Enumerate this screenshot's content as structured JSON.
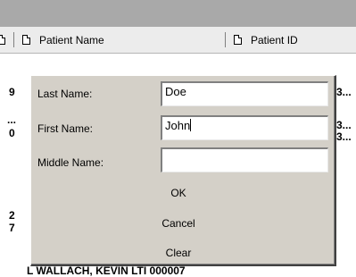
{
  "header": {
    "columns": [
      {
        "label": "Patient Name"
      },
      {
        "label": "Patient ID"
      }
    ]
  },
  "background": {
    "left_fragments": [
      "9",
      "...",
      "0",
      "2",
      "7"
    ],
    "right_fragments": [
      "3...",
      "3...",
      "3..."
    ],
    "bottom_partial": "L WALLACH, KEVIN          LTI 000007"
  },
  "dialog": {
    "last_name_label": "Last Name:",
    "last_name_value": "Doe",
    "first_name_label": "First Name:",
    "first_name_value": "John",
    "middle_name_label": "Middle Name:",
    "middle_name_value": "",
    "ok_label": "OK",
    "cancel_label": "Cancel",
    "clear_label": "Clear"
  }
}
